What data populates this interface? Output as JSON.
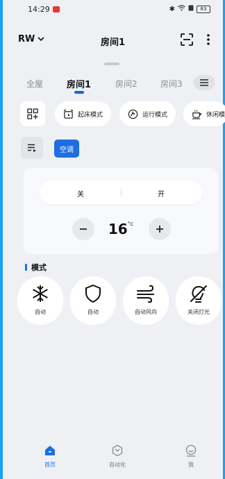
{
  "status_bar": {
    "time": "14:29",
    "battery": "83"
  },
  "header": {
    "home_selector": "RW",
    "title": "房间1"
  },
  "tabs": [
    {
      "label": "全屋"
    },
    {
      "label": "房间1"
    },
    {
      "label": "房间2"
    },
    {
      "label": "房间3"
    }
  ],
  "scenes": [
    {
      "label": "起床模式",
      "icon": "alarm-clock-icon"
    },
    {
      "label": "运行模式",
      "icon": "run-icon"
    },
    {
      "label": "休闲模",
      "icon": "coffee-cup-icon"
    }
  ],
  "device_chip": "空调",
  "power": {
    "off_label": "关",
    "on_label": "开"
  },
  "temperature": {
    "value": "16",
    "unit": "°c"
  },
  "modes_title": "模式",
  "modes": [
    {
      "label": "自动",
      "icon": "snowflake-icon"
    },
    {
      "label": "自动",
      "icon": "shield-icon"
    },
    {
      "label": "自动风向",
      "icon": "wind-icon"
    },
    {
      "label": "关闭灯光",
      "icon": "light-off-icon"
    }
  ],
  "bottom_nav": [
    {
      "label": "首页",
      "icon": "home-icon"
    },
    {
      "label": "自动化",
      "icon": "automation-icon"
    },
    {
      "label": "我",
      "icon": "profile-icon"
    }
  ],
  "colors": {
    "accent": "#1d6fe0",
    "background": "#eef0f4",
    "frame_border": "#1aa0ee"
  }
}
